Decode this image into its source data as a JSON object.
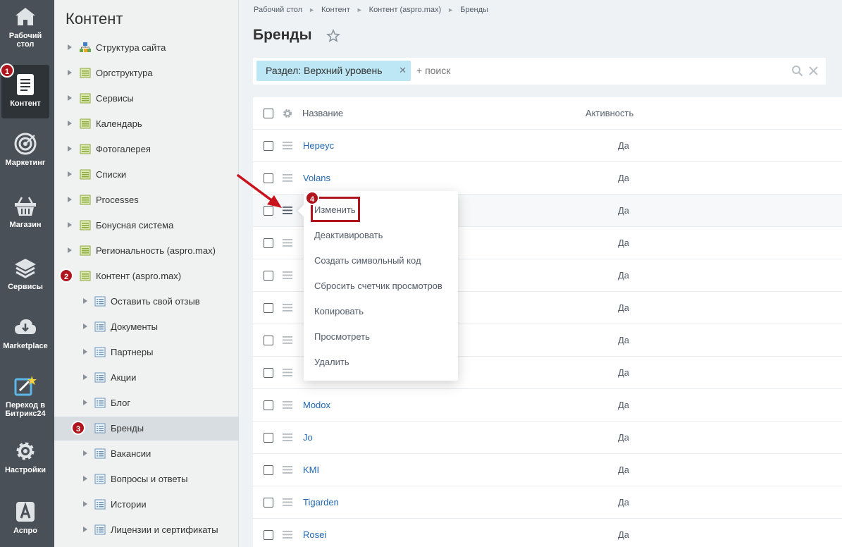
{
  "rail": {
    "items": [
      {
        "label": "Рабочий стол",
        "icon": "home-icon"
      },
      {
        "label": "Контент",
        "icon": "document-icon",
        "badge": "1"
      },
      {
        "label": "Маркетинг",
        "icon": "target-icon"
      },
      {
        "label": "Магазин",
        "icon": "basket-icon"
      },
      {
        "label": "Сервисы",
        "icon": "layers-icon"
      },
      {
        "label": "Marketplace",
        "icon": "cloud-download-icon"
      },
      {
        "label": "Переход в Битрикс24",
        "icon": "bitrix24-icon"
      },
      {
        "label": "Настройки",
        "icon": "gear-icon"
      },
      {
        "label": "Аспро",
        "icon": "aspro-logo-icon"
      }
    ]
  },
  "tree": {
    "title": "Контент",
    "items": [
      {
        "label": "Структура сайта",
        "icon": "structure-icon"
      },
      {
        "label": "Оргструктура",
        "icon": "folder-icon"
      },
      {
        "label": "Сервисы",
        "icon": "folder-icon"
      },
      {
        "label": "Календарь",
        "icon": "folder-icon"
      },
      {
        "label": "Фотогалерея",
        "icon": "folder-icon"
      },
      {
        "label": "Списки",
        "icon": "folder-icon"
      },
      {
        "label": "Processes",
        "icon": "folder-icon"
      },
      {
        "label": "Бонусная система",
        "icon": "folder-icon"
      },
      {
        "label": "Региональность (aspro.max)",
        "icon": "folder-icon"
      },
      {
        "label": "Контент (aspro.max)",
        "icon": "folder-icon",
        "badge": "2"
      },
      {
        "label": "Оставить свой отзыв",
        "icon": "list-icon"
      },
      {
        "label": "Документы",
        "icon": "list-icon"
      },
      {
        "label": "Партнеры",
        "icon": "list-icon"
      },
      {
        "label": "Акции",
        "icon": "list-icon"
      },
      {
        "label": "Блог",
        "icon": "list-icon"
      },
      {
        "label": "Бренды",
        "icon": "list-icon",
        "badge": "3",
        "selected": true
      },
      {
        "label": "Вакансии",
        "icon": "list-icon"
      },
      {
        "label": "Вопросы и ответы",
        "icon": "list-icon"
      },
      {
        "label": "Истории",
        "icon": "list-icon"
      },
      {
        "label": "Лицензии и сертификаты",
        "icon": "list-icon"
      }
    ]
  },
  "breadcrumb": [
    "Рабочий стол",
    "Контент",
    "Контент (aspro.max)",
    "Бренды"
  ],
  "page_title": "Бренды",
  "filter": {
    "chip": "Раздел: Верхний уровень",
    "placeholder": "+ поиск"
  },
  "grid": {
    "columns": [
      "Название",
      "Активность"
    ],
    "rows": [
      {
        "name": "Hepeyc",
        "active": "Да"
      },
      {
        "name": "Volans",
        "active": "Да"
      },
      {
        "name": "",
        "active": "Да"
      },
      {
        "name": "",
        "active": "Да"
      },
      {
        "name": "",
        "active": "Да"
      },
      {
        "name": "",
        "active": "Да"
      },
      {
        "name": "",
        "active": "Да"
      },
      {
        "name": "",
        "active": "Да"
      },
      {
        "name": "Modox",
        "active": "Да"
      },
      {
        "name": "Jo",
        "active": "Да"
      },
      {
        "name": "KMI",
        "active": "Да"
      },
      {
        "name": "Tigarden",
        "active": "Да"
      },
      {
        "name": "Rosei",
        "active": "Да"
      }
    ]
  },
  "context_menu": {
    "badge": "4",
    "items": [
      "Изменить",
      "Деактивировать",
      "Создать символьный код",
      "Сбросить счетчик просмотров",
      "Копировать",
      "Просмотреть",
      "Удалить"
    ]
  },
  "colors": {
    "rail_bg": "#4a5057",
    "badge": "#b0151e",
    "link": "#2067b0",
    "chip": "#bde7f4"
  }
}
